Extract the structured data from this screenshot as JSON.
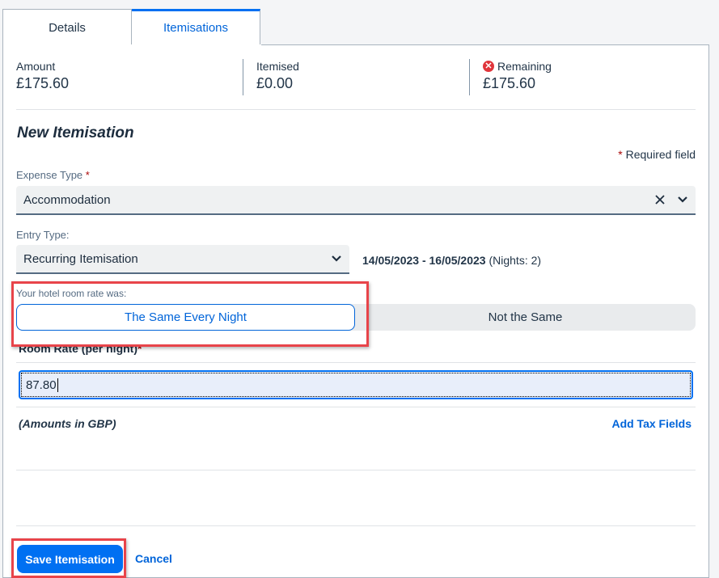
{
  "tabs": [
    {
      "label": "Details",
      "active": false
    },
    {
      "label": "Itemisations",
      "active": true
    }
  ],
  "summary": {
    "amount": {
      "label": "Amount",
      "value": "£175.60"
    },
    "itemised": {
      "label": "Itemised",
      "value": "£0.00"
    },
    "remaining": {
      "label": "Remaining",
      "value": "£175.60",
      "status_icon": "error-icon"
    }
  },
  "form": {
    "title": "New Itemisation",
    "required_note": "Required field",
    "required_mark": "*",
    "expense_type": {
      "label": "Expense Type",
      "value": "Accommodation"
    },
    "entry_type": {
      "label": "Entry Type:",
      "value": "Recurring Itemisation"
    },
    "date_range": {
      "dates": "14/05/2023 - 16/05/2023",
      "nights": "(Nights: 2)"
    },
    "room_rate_question": {
      "label": "Your hotel room rate was:",
      "options": [
        {
          "label": "The Same Every Night",
          "selected": true
        },
        {
          "label": "Not the Same",
          "selected": false
        }
      ]
    },
    "room_rate": {
      "label": "Room Rate (per night)",
      "value": "87.80"
    },
    "amounts_note": "(Amounts in GBP)",
    "add_tax_fields": "Add Tax Fields"
  },
  "actions": {
    "save": "Save Itemisation",
    "cancel": "Cancel"
  },
  "colors": {
    "accent": "#0070f2",
    "error": "#e0353b",
    "highlight": "#e8444a"
  }
}
